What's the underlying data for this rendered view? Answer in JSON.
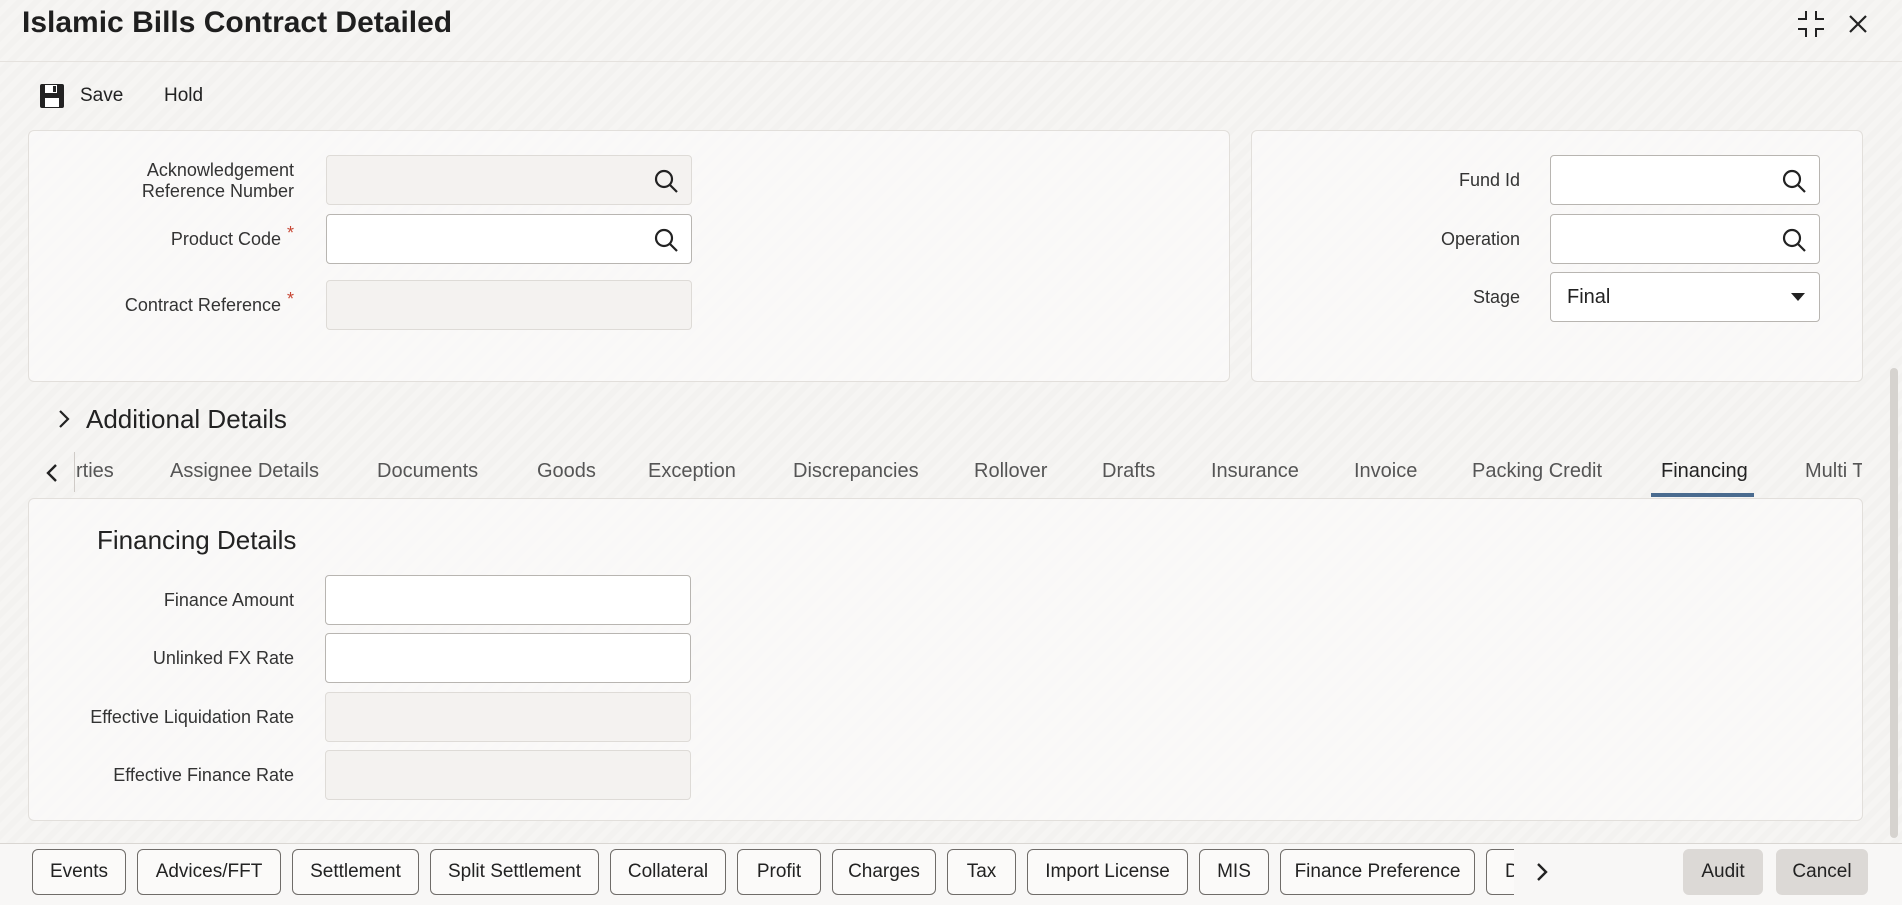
{
  "window": {
    "title": "Islamic Bills Contract Detailed",
    "icons": {
      "restore": "compress-icon",
      "close": "close-icon"
    }
  },
  "toolbar": {
    "save_label": "Save",
    "hold_label": "Hold",
    "save_icon": "floppy-disk-icon"
  },
  "header": {
    "ack_ref_label_line1": "Acknowledgement",
    "ack_ref_label_line2": "Reference Number",
    "ack_ref_value": "",
    "product_code_label": "Product Code",
    "product_code_value": "",
    "contract_ref_label": "Contract Reference",
    "contract_ref_value": "",
    "required_marker": "*",
    "fund_id_label": "Fund Id",
    "fund_id_value": "",
    "operation_label": "Operation",
    "operation_value": "",
    "stage_label": "Stage",
    "stage_value": "Final"
  },
  "additional_details": {
    "label": "Additional Details"
  },
  "tabs": {
    "items": [
      {
        "label": "rties"
      },
      {
        "label": "Assignee Details"
      },
      {
        "label": "Documents"
      },
      {
        "label": "Goods"
      },
      {
        "label": "Exception"
      },
      {
        "label": "Discrepancies"
      },
      {
        "label": "Rollover"
      },
      {
        "label": "Drafts"
      },
      {
        "label": "Insurance"
      },
      {
        "label": "Invoice"
      },
      {
        "label": "Packing Credit"
      },
      {
        "label": "Financing"
      },
      {
        "label": "Multi T"
      }
    ],
    "active": "Financing"
  },
  "financing": {
    "title": "Financing Details",
    "finance_amount_label": "Finance Amount",
    "finance_amount_value": "",
    "unlinked_fx_label": "Unlinked FX Rate",
    "unlinked_fx_value": "",
    "eff_liq_label": "Effective Liquidation Rate",
    "eff_liq_value": "",
    "eff_fin_label": "Effective Finance Rate",
    "eff_fin_value": ""
  },
  "footer": {
    "buttons": [
      {
        "label": "Events"
      },
      {
        "label": "Advices/FFT"
      },
      {
        "label": "Settlement"
      },
      {
        "label": "Split Settlement"
      },
      {
        "label": "Collateral"
      },
      {
        "label": "Profit"
      },
      {
        "label": "Charges"
      },
      {
        "label": "Tax"
      },
      {
        "label": "Import License"
      },
      {
        "label": "MIS"
      },
      {
        "label": "Finance Preference"
      },
      {
        "label": "D"
      }
    ],
    "audit_label": "Audit",
    "cancel_label": "Cancel"
  },
  "colors": {
    "accent": "#4a6b8f",
    "required": "#c74634"
  }
}
